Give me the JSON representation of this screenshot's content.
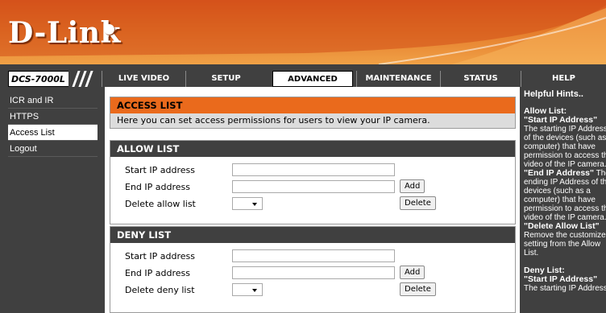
{
  "brand": {
    "logo": "D-Link",
    "model": "DCS-7000L"
  },
  "nav": {
    "tabs": [
      {
        "label": "LIVE VIDEO",
        "active": false
      },
      {
        "label": "SETUP",
        "active": false
      },
      {
        "label": "ADVANCED",
        "active": true
      },
      {
        "label": "MAINTENANCE",
        "active": false
      },
      {
        "label": "STATUS",
        "active": false
      },
      {
        "label": "HELP",
        "active": false
      }
    ]
  },
  "sidebar": {
    "items": [
      {
        "label": "ICR and IR",
        "active": false
      },
      {
        "label": "HTTPS",
        "active": false
      },
      {
        "label": "Access List",
        "active": true
      },
      {
        "label": "Logout",
        "active": false
      }
    ]
  },
  "access_list": {
    "title": "ACCESS LIST",
    "intro": "Here you can set access permissions for users to view your IP camera."
  },
  "allow_list": {
    "title": "ALLOW LIST",
    "start_label": "Start IP address",
    "start_value": "",
    "end_label": "End IP address",
    "end_value": "",
    "delete_label": "Delete allow list",
    "delete_selected": "",
    "add_button": "Add",
    "delete_button": "Delete"
  },
  "deny_list": {
    "title": "DENY LIST",
    "start_label": "Start IP address",
    "start_value": "",
    "end_label": "End IP address",
    "end_value": "",
    "delete_label": "Delete deny list",
    "delete_selected": "",
    "add_button": "Add",
    "delete_button": "Delete"
  },
  "help": {
    "title": "Helpful Hints..",
    "allow_heading": "Allow List:",
    "allow_start_heading": "\"Start IP Address\"",
    "allow_start_lines": [
      "The starting IP Address",
      "of the devices (such as",
      "computer) that have",
      "permission to access the",
      "video of the IP camera."
    ],
    "allow_end_heading": "\"End IP Address\"",
    "allow_end_suffix": " The",
    "allow_end_lines": [
      "ending IP Address of the",
      "devices (such as a",
      "computer) that have",
      "permission to access the",
      "video of the IP camera."
    ],
    "allow_delete_heading": "\"Delete Allow List\"",
    "allow_delete_lines": [
      "Remove the customized",
      "setting from the Allow",
      "List."
    ],
    "deny_heading": "Deny List:",
    "deny_start_heading": "\"Start IP Address\"",
    "deny_start_lines": [
      "The starting IP Address"
    ]
  },
  "colors": {
    "orange_header": "#ea6a1c",
    "dark_bg": "#404040",
    "intro_bg": "#dcdcdc"
  }
}
